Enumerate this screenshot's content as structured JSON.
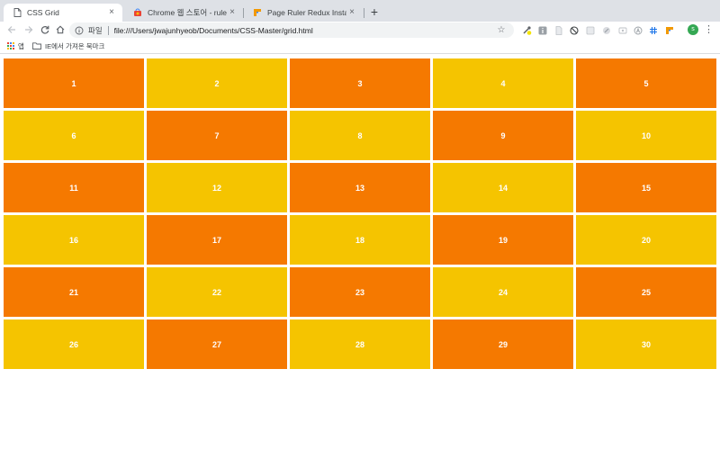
{
  "browser": {
    "tabs": [
      {
        "title": "CSS Grid",
        "icon": "document-icon",
        "active": true
      },
      {
        "title": "Chrome 웹 스토어 - ruler",
        "icon": "chrome-web-store-icon",
        "active": false
      },
      {
        "title": "Page Ruler Redux Installed",
        "icon": "page-ruler-icon",
        "active": false
      }
    ],
    "new_tab_label": "+",
    "close_label": "×",
    "address": {
      "scheme_label": "파일",
      "url": "file:///Users/jwajunhyeob/Documents/CSS-Master/grid.html"
    },
    "profile_initial": "s",
    "bookmarks": [
      {
        "label": "앱",
        "icon": "apps-grid-icon"
      },
      {
        "label": "IE에서 가져온 북마크",
        "icon": "folder-icon"
      }
    ]
  },
  "colors": {
    "orange": "#f57900",
    "yellow": "#f5c400",
    "tabstrip": "#dee1e6",
    "omnibox": "#f1f3f4"
  },
  "grid": {
    "columns": 5,
    "items": [
      {
        "label": "1",
        "color": "orange"
      },
      {
        "label": "2",
        "color": "yellow"
      },
      {
        "label": "3",
        "color": "orange"
      },
      {
        "label": "4",
        "color": "yellow"
      },
      {
        "label": "5",
        "color": "orange"
      },
      {
        "label": "6",
        "color": "yellow"
      },
      {
        "label": "7",
        "color": "orange"
      },
      {
        "label": "8",
        "color": "yellow"
      },
      {
        "label": "9",
        "color": "orange"
      },
      {
        "label": "10",
        "color": "yellow"
      },
      {
        "label": "11",
        "color": "orange"
      },
      {
        "label": "12",
        "color": "yellow"
      },
      {
        "label": "13",
        "color": "orange"
      },
      {
        "label": "14",
        "color": "yellow"
      },
      {
        "label": "15",
        "color": "orange"
      },
      {
        "label": "16",
        "color": "yellow"
      },
      {
        "label": "17",
        "color": "orange"
      },
      {
        "label": "18",
        "color": "yellow"
      },
      {
        "label": "19",
        "color": "orange"
      },
      {
        "label": "20",
        "color": "yellow"
      },
      {
        "label": "21",
        "color": "orange"
      },
      {
        "label": "22",
        "color": "yellow"
      },
      {
        "label": "23",
        "color": "orange"
      },
      {
        "label": "24",
        "color": "yellow"
      },
      {
        "label": "25",
        "color": "orange"
      },
      {
        "label": "26",
        "color": "yellow"
      },
      {
        "label": "27",
        "color": "orange"
      },
      {
        "label": "28",
        "color": "yellow"
      },
      {
        "label": "29",
        "color": "orange"
      },
      {
        "label": "30",
        "color": "yellow"
      }
    ]
  }
}
